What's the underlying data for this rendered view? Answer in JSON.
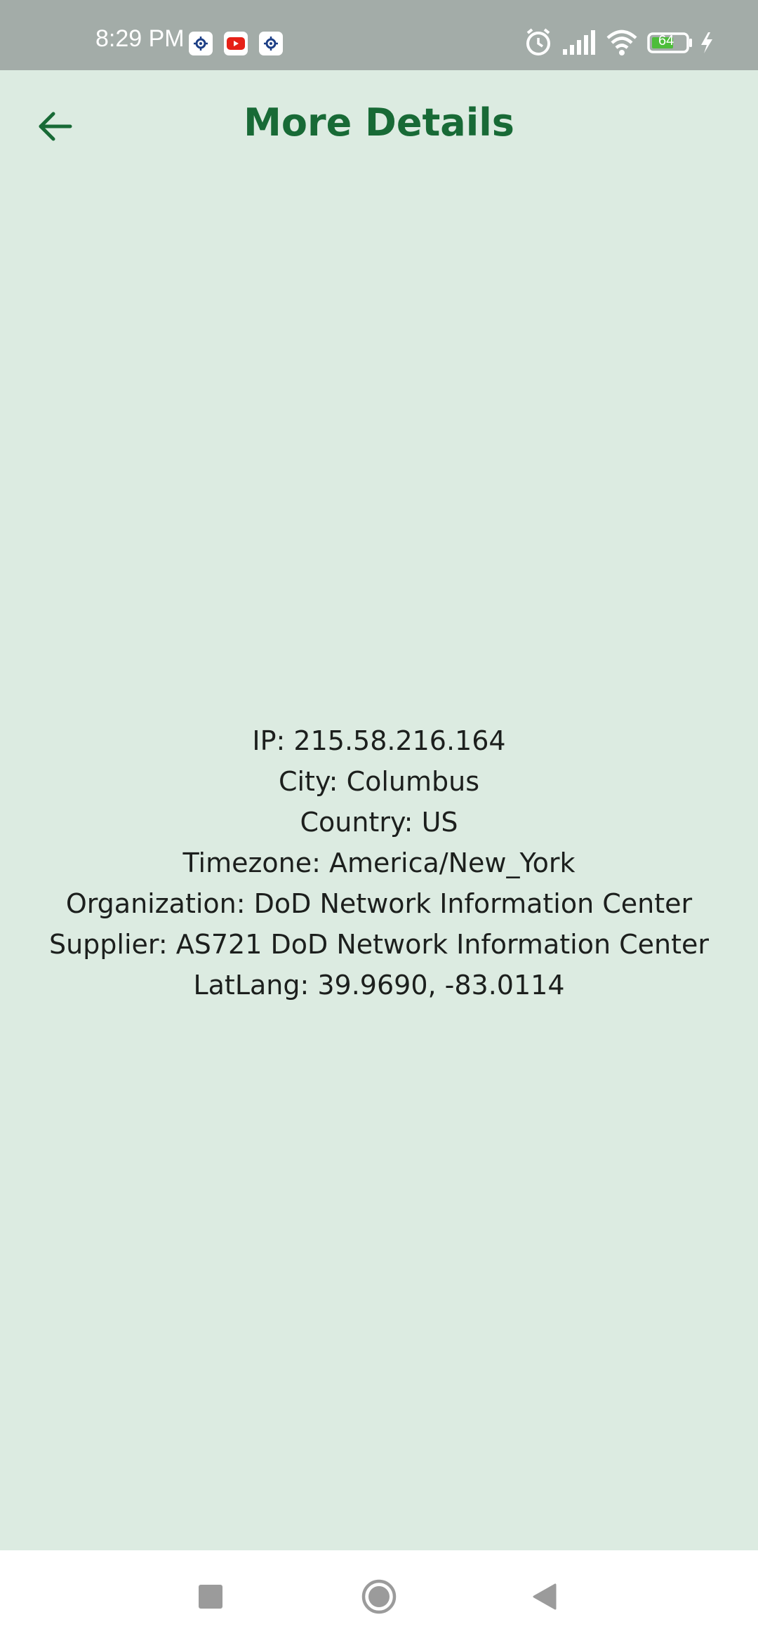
{
  "status_bar": {
    "time": "8:29 PM",
    "battery_level": "64",
    "icons": [
      "settings-app-icon",
      "youtube-icon",
      "settings-app-icon",
      "alarm-icon",
      "signal-icon",
      "wifi-icon",
      "battery-icon",
      "charging-icon"
    ]
  },
  "app_bar": {
    "title": "More Details",
    "back_icon": "arrow-left-icon"
  },
  "details": {
    "ip": "IP: 215.58.216.164",
    "city": "City: Columbus",
    "country": "Country: US",
    "timezone": "Timezone: America/New_York",
    "organization": "Organization: DoD Network Information Center",
    "supplier": "Supplier: AS721 DoD Network Information Center",
    "latlang": "LatLang: 39.9690, -83.0114"
  },
  "nav_bar": {
    "buttons": [
      "recents-square-icon",
      "home-circle-icon",
      "back-triangle-icon"
    ]
  },
  "colors": {
    "background": "#dcebe1",
    "accent": "#186a36",
    "status_bar": "#a3aca8",
    "text": "#1c1f1d"
  }
}
